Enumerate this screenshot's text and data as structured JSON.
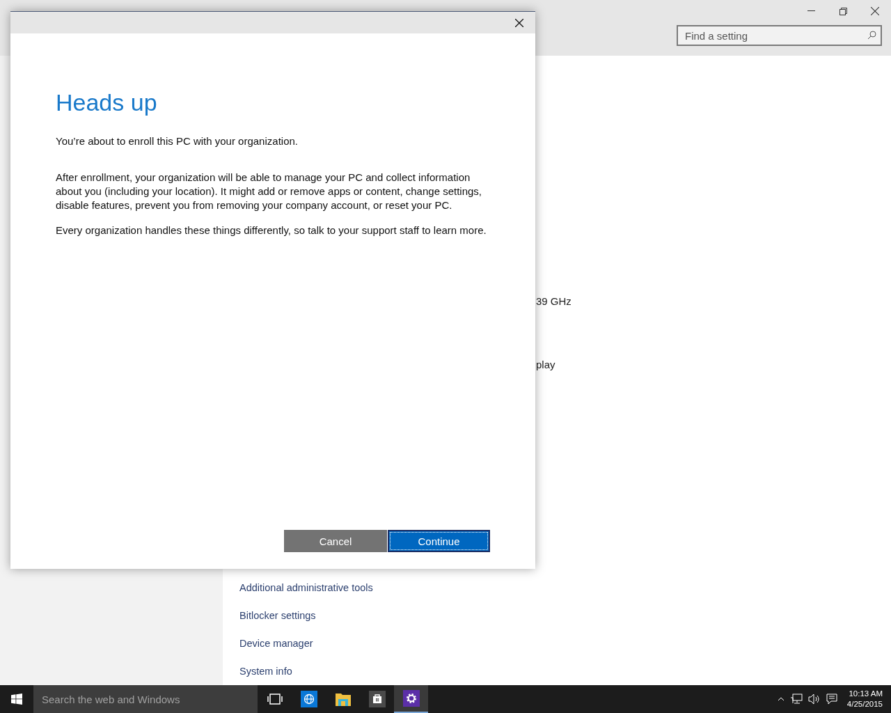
{
  "window": {
    "search": {
      "placeholder": "Find a setting"
    }
  },
  "content": {
    "fragments": [
      "39 GHz",
      "play"
    ],
    "links": [
      "Additional administrative tools",
      "Bitlocker settings",
      "Device manager",
      "System info"
    ]
  },
  "dialog": {
    "title": "Heads up",
    "paragraphs": [
      "You’re about to enroll this PC with your organization.",
      "After enrollment, your organization will be able to manage your PC and collect information about you (including your location). It might add or remove apps or content, change settings, disable features, prevent you from removing your company account, or reset your PC.",
      "Every organization handles these things differently, so talk to your support staff to learn more."
    ],
    "buttons": [
      {
        "label": "Cancel",
        "kind": "secondary"
      },
      {
        "label": "Continue",
        "kind": "primary"
      }
    ]
  },
  "taskbar": {
    "search": {
      "placeholder": "Search the web and Windows"
    },
    "apps": [
      {
        "kind": "taskview",
        "selected": false
      },
      {
        "kind": "globe",
        "selected": false
      },
      {
        "kind": "folder",
        "selected": false
      },
      {
        "kind": "store",
        "selected": false
      },
      {
        "kind": "gear",
        "selected": true
      }
    ],
    "time": "10:13 AM",
    "date": "4/25/2015"
  }
}
